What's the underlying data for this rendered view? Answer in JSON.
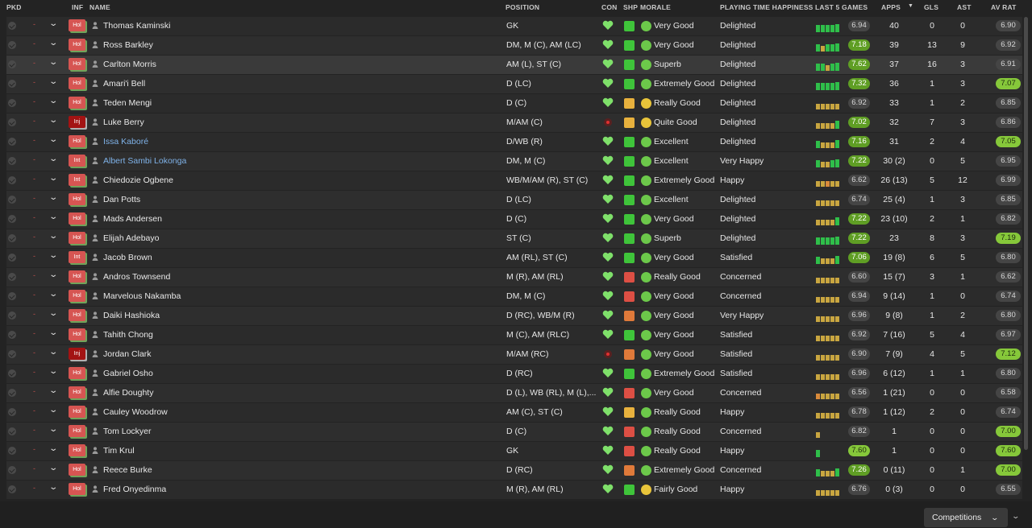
{
  "columns": {
    "pkd": "PKD",
    "inf": "INF",
    "name": "NAME",
    "position": "POSITION",
    "con": "CON",
    "shp": "SHP",
    "morale": "MORALE",
    "pth": "PLAYING TIME HAPPINESS",
    "last5": "LAST 5 GAMES",
    "apps": "APPS",
    "gls": "GLS",
    "ast": "AST",
    "avrat": "AV RAT"
  },
  "competitions_label": "Competitions",
  "colors": {
    "form_green": "#2fbf4a",
    "form_yellow": "#c9a640",
    "form_orange": "#d98a3a",
    "heart": "#7fe06a",
    "rating_green": "#5f9e24",
    "rating_lime": "#86c83a",
    "injury": "#a31313",
    "hol": "#d65552"
  },
  "players": [
    {
      "name": "Thomas Kaminski",
      "inf": "Hol",
      "position": "GK",
      "con": "ok",
      "shp": "g",
      "mor": "g",
      "morale": "Very Good",
      "pth": "Delighted",
      "form": [
        "g",
        "g",
        "g",
        "g",
        "g"
      ],
      "last": "6.94",
      "lastc": "dark",
      "apps": "40",
      "gls": "0",
      "ast": "0",
      "av": "6.90",
      "avc": "dark"
    },
    {
      "name": "Ross Barkley",
      "inf": "Hol",
      "position": "DM, M (C), AM (LC)",
      "con": "ok",
      "shp": "g",
      "mor": "g",
      "morale": "Very Good",
      "pth": "Delighted",
      "form": [
        "g",
        "y",
        "g",
        "g",
        "g"
      ],
      "last": "7.18",
      "lastc": "green",
      "apps": "39",
      "gls": "13",
      "ast": "9",
      "av": "6.92",
      "avc": "dark"
    },
    {
      "name": "Carlton Morris",
      "inf": "Hol",
      "position": "AM (L), ST (C)",
      "con": "ok",
      "shp": "g",
      "mor": "g",
      "morale": "Superb",
      "pth": "Delighted",
      "form": [
        "g",
        "g",
        "y",
        "g",
        "g"
      ],
      "last": "7.62",
      "lastc": "green",
      "apps": "37",
      "gls": "16",
      "ast": "3",
      "av": "6.91",
      "avc": "dark",
      "hl": true
    },
    {
      "name": "Amari'i Bell",
      "inf": "Hol",
      "position": "D (LC)",
      "con": "ok",
      "shp": "g",
      "mor": "g",
      "morale": "Extremely Good",
      "pth": "Delighted",
      "form": [
        "g",
        "g",
        "g",
        "g",
        "g"
      ],
      "last": "7.32",
      "lastc": "green",
      "apps": "36",
      "gls": "1",
      "ast": "3",
      "av": "7.07",
      "avc": "lime"
    },
    {
      "name": "Teden Mengi",
      "inf": "Hol",
      "position": "D (C)",
      "con": "ok",
      "shp": "y",
      "mor": "y",
      "morale": "Really Good",
      "pth": "Delighted",
      "form": [
        "y",
        "y",
        "y",
        "y",
        "y"
      ],
      "last": "6.92",
      "lastc": "dark",
      "apps": "33",
      "gls": "1",
      "ast": "2",
      "av": "6.85",
      "avc": "dark"
    },
    {
      "name": "Luke Berry",
      "inf": "Inj",
      "position": "M/AM (C)",
      "con": "inj",
      "shp": "y",
      "mor": "y",
      "morale": "Quite Good",
      "pth": "Delighted",
      "form": [
        "y",
        "y",
        "y",
        "y",
        "g"
      ],
      "last": "7.02",
      "lastc": "green",
      "apps": "32",
      "gls": "7",
      "ast": "3",
      "av": "6.86",
      "avc": "dark"
    },
    {
      "name": "Issa Kaboré",
      "inf": "Hol",
      "position": "D/WB (R)",
      "con": "ok",
      "shp": "g",
      "mor": "g",
      "morale": "Excellent",
      "pth": "Delighted",
      "form": [
        "g",
        "y",
        "y",
        "y",
        "g"
      ],
      "last": "7.16",
      "lastc": "green",
      "apps": "31",
      "gls": "2",
      "ast": "4",
      "av": "7.05",
      "avc": "lime",
      "link": true
    },
    {
      "name": "Albert Sambi Lokonga",
      "inf": "Int",
      "position": "DM, M (C)",
      "con": "ok",
      "shp": "g",
      "mor": "g",
      "morale": "Excellent",
      "pth": "Very Happy",
      "form": [
        "g",
        "y",
        "y",
        "g",
        "g"
      ],
      "last": "7.22",
      "lastc": "green",
      "apps": "30 (2)",
      "gls": "0",
      "ast": "5",
      "av": "6.95",
      "avc": "dark",
      "link": true
    },
    {
      "name": "Chiedozie Ogbene",
      "inf": "Int",
      "position": "WB/M/AM (R), ST (C)",
      "con": "ok",
      "shp": "g",
      "mor": "g",
      "morale": "Extremely Good",
      "pth": "Happy",
      "form": [
        "y",
        "y",
        "o",
        "y",
        "y"
      ],
      "last": "6.62",
      "lastc": "dark",
      "apps": "26 (13)",
      "gls": "5",
      "ast": "12",
      "av": "6.99",
      "avc": "dark"
    },
    {
      "name": "Dan Potts",
      "inf": "Hol",
      "position": "D (LC)",
      "con": "ok",
      "shp": "g",
      "mor": "g",
      "morale": "Excellent",
      "pth": "Delighted",
      "form": [
        "y",
        "y",
        "y",
        "y",
        "y"
      ],
      "last": "6.74",
      "lastc": "dark",
      "apps": "25 (4)",
      "gls": "1",
      "ast": "3",
      "av": "6.85",
      "avc": "dark"
    },
    {
      "name": "Mads Andersen",
      "inf": "Hol",
      "position": "D (C)",
      "con": "ok",
      "shp": "g",
      "mor": "g",
      "morale": "Very Good",
      "pth": "Delighted",
      "form": [
        "y",
        "y",
        "y",
        "y",
        "g"
      ],
      "last": "7.22",
      "lastc": "green",
      "apps": "23 (10)",
      "gls": "2",
      "ast": "1",
      "av": "6.82",
      "avc": "dark"
    },
    {
      "name": "Elijah Adebayo",
      "inf": "Hol",
      "position": "ST (C)",
      "con": "ok",
      "shp": "g",
      "mor": "g",
      "morale": "Superb",
      "pth": "Delighted",
      "form": [
        "g",
        "g",
        "g",
        "g",
        "g"
      ],
      "last": "7.22",
      "lastc": "green",
      "apps": "23",
      "gls": "8",
      "ast": "3",
      "av": "7.19",
      "avc": "lime"
    },
    {
      "name": "Jacob Brown",
      "inf": "Int",
      "position": "AM (RL), ST (C)",
      "con": "ok",
      "shp": "g",
      "mor": "g",
      "morale": "Very Good",
      "pth": "Satisfied",
      "form": [
        "g",
        "y",
        "y",
        "y",
        "g"
      ],
      "last": "7.06",
      "lastc": "green",
      "apps": "19 (8)",
      "gls": "6",
      "ast": "5",
      "av": "6.80",
      "avc": "dark"
    },
    {
      "name": "Andros Townsend",
      "inf": "Hol",
      "position": "M (R), AM (RL)",
      "con": "ok",
      "shp": "r",
      "mor": "g",
      "morale": "Really Good",
      "pth": "Concerned",
      "form": [
        "y",
        "y",
        "y",
        "y",
        "y"
      ],
      "last": "6.60",
      "lastc": "dark",
      "apps": "15 (7)",
      "gls": "3",
      "ast": "1",
      "av": "6.62",
      "avc": "dark"
    },
    {
      "name": "Marvelous Nakamba",
      "inf": "Hol",
      "position": "DM, M (C)",
      "con": "ok",
      "shp": "r",
      "mor": "g",
      "morale": "Very Good",
      "pth": "Concerned",
      "form": [
        "y",
        "y",
        "y",
        "y",
        "y"
      ],
      "last": "6.94",
      "lastc": "dark",
      "apps": "9 (14)",
      "gls": "1",
      "ast": "0",
      "av": "6.74",
      "avc": "dark"
    },
    {
      "name": "Daiki Hashioka",
      "inf": "Hol",
      "position": "D (RC), WB/M (R)",
      "con": "ok",
      "shp": "o",
      "mor": "g",
      "morale": "Very Good",
      "pth": "Very Happy",
      "form": [
        "y",
        "y",
        "y",
        "y",
        "y"
      ],
      "last": "6.96",
      "lastc": "dark",
      "apps": "9 (8)",
      "gls": "1",
      "ast": "2",
      "av": "6.80",
      "avc": "dark"
    },
    {
      "name": "Tahith Chong",
      "inf": "Hol",
      "position": "M (C), AM (RLC)",
      "con": "ok",
      "shp": "g",
      "mor": "g",
      "morale": "Very Good",
      "pth": "Satisfied",
      "form": [
        "y",
        "y",
        "y",
        "y",
        "y"
      ],
      "last": "6.92",
      "lastc": "dark",
      "apps": "7 (16)",
      "gls": "5",
      "ast": "4",
      "av": "6.97",
      "avc": "dark"
    },
    {
      "name": "Jordan Clark",
      "inf": "Inj",
      "position": "M/AM (RC)",
      "con": "inj",
      "shp": "o",
      "mor": "g",
      "morale": "Very Good",
      "pth": "Satisfied",
      "form": [
        "y",
        "y",
        "y",
        "y",
        "y"
      ],
      "last": "6.90",
      "lastc": "dark",
      "apps": "7 (9)",
      "gls": "4",
      "ast": "5",
      "av": "7.12",
      "avc": "lime"
    },
    {
      "name": "Gabriel Osho",
      "inf": "Hol",
      "position": "D (RC)",
      "con": "ok",
      "shp": "g",
      "mor": "g",
      "morale": "Extremely Good",
      "pth": "Satisfied",
      "form": [
        "y",
        "y",
        "y",
        "y",
        "y"
      ],
      "last": "6.96",
      "lastc": "dark",
      "apps": "6 (12)",
      "gls": "1",
      "ast": "1",
      "av": "6.80",
      "avc": "dark"
    },
    {
      "name": "Alfie Doughty",
      "inf": "Hol",
      "position": "D (L), WB (RL), M (L),...",
      "con": "ok",
      "shp": "r",
      "mor": "g",
      "morale": "Very Good",
      "pth": "Concerned",
      "form": [
        "o",
        "y",
        "y",
        "y",
        "y"
      ],
      "last": "6.56",
      "lastc": "dark",
      "apps": "1 (21)",
      "gls": "0",
      "ast": "0",
      "av": "6.58",
      "avc": "dark"
    },
    {
      "name": "Cauley Woodrow",
      "inf": "Hol",
      "position": "AM (C), ST (C)",
      "con": "ok",
      "shp": "y",
      "mor": "g",
      "morale": "Really Good",
      "pth": "Happy",
      "form": [
        "y",
        "y",
        "y",
        "y",
        "y"
      ],
      "last": "6.78",
      "lastc": "dark",
      "apps": "1 (12)",
      "gls": "2",
      "ast": "0",
      "av": "6.74",
      "avc": "dark"
    },
    {
      "name": "Tom Lockyer",
      "inf": "Hol",
      "position": "D (C)",
      "con": "ok",
      "shp": "r",
      "mor": "g",
      "morale": "Really Good",
      "pth": "Concerned",
      "form": [
        "y"
      ],
      "last": "6.82",
      "lastc": "dark",
      "apps": "1",
      "gls": "0",
      "ast": "0",
      "av": "7.00",
      "avc": "lime"
    },
    {
      "name": "Tim Krul",
      "inf": "Hol",
      "position": "GK",
      "con": "ok",
      "shp": "r",
      "mor": "g",
      "morale": "Really Good",
      "pth": "Happy",
      "form": [
        "g"
      ],
      "last": "7.60",
      "lastc": "lime",
      "apps": "1",
      "gls": "0",
      "ast": "0",
      "av": "7.60",
      "avc": "lime"
    },
    {
      "name": "Reece Burke",
      "inf": "Hol",
      "position": "D (RC)",
      "con": "ok",
      "shp": "o",
      "mor": "g",
      "morale": "Extremely Good",
      "pth": "Concerned",
      "form": [
        "g",
        "y",
        "y",
        "y",
        "g"
      ],
      "last": "7.26",
      "lastc": "green",
      "apps": "0 (11)",
      "gls": "0",
      "ast": "1",
      "av": "7.00",
      "avc": "lime"
    },
    {
      "name": "Fred Onyedinma",
      "inf": "Hol",
      "position": "M (R), AM (RL)",
      "con": "ok",
      "shp": "g",
      "mor": "y",
      "morale": "Fairly Good",
      "pth": "Happy",
      "form": [
        "y",
        "y",
        "y",
        "y",
        "y"
      ],
      "last": "6.76",
      "lastc": "dark",
      "apps": "0 (3)",
      "gls": "0",
      "ast": "0",
      "av": "6.55",
      "avc": "dark"
    }
  ]
}
